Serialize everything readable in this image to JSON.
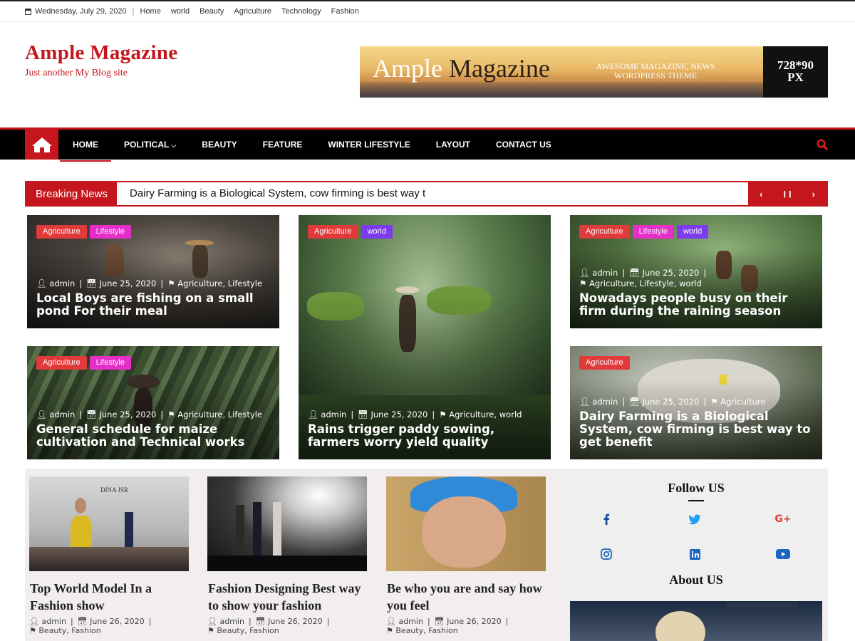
{
  "topbar": {
    "date": "Wednesday, July 29, 2020",
    "links": [
      "Home",
      "world",
      "Beauty",
      "Agriculture",
      "Technology",
      "Fashion"
    ]
  },
  "site": {
    "title": "Ample Magazine",
    "tagline": "Just another My Blog site"
  },
  "ad": {
    "name_dark": "Ample",
    "name_light": " Magazine",
    "desc": "AWESOME MAGAZINE, NEWS WORDPRESS THEME",
    "size_line1": "728*90",
    "size_line2": "PX"
  },
  "nav": {
    "items": [
      "HOME",
      "POLITICAL",
      "BEAUTY",
      "FEATURE",
      "WINTER LIFESTYLE",
      "LAYOUT",
      "CONTACT US"
    ],
    "active": "HOME"
  },
  "breaking": {
    "label": "Breaking News",
    "text": "Dairy Farming is a Biological System, cow firming is best way t",
    "prev": "‹",
    "pause": "❙❙",
    "next": "›"
  },
  "featured": [
    {
      "tags": [
        "Agriculture",
        "Lifestyle"
      ],
      "author": "admin",
      "date": "June 25, 2020",
      "cats": "Agriculture, Lifestyle",
      "title": "Local Boys are fishing on a small pond For their meal"
    },
    {
      "tags": [
        "Agriculture",
        "world"
      ],
      "author": "admin",
      "date": "June 25, 2020",
      "cats": "Agriculture, world",
      "title": "Rains trigger paddy sowing, farmers worry yield quality"
    },
    {
      "tags": [
        "Agriculture",
        "Lifestyle",
        "world"
      ],
      "author": "admin",
      "date": "June 25, 2020",
      "cats": "Agriculture, Lifestyle, world",
      "title": "Nowadays people busy on their firm during the raining season"
    },
    {
      "tags": [
        "Agriculture",
        "Lifestyle"
      ],
      "author": "admin",
      "date": "June 25, 2020",
      "cats": "Agriculture, Lifestyle",
      "title": "General schedule for maize cultivation and Technical works"
    },
    {
      "tags": [
        "Agriculture"
      ],
      "author": "admin",
      "date": "June 25, 2020",
      "cats": "Agriculture",
      "title": "Dairy Farming is a Biological System, cow firming is best way to get benefit"
    }
  ],
  "posts": [
    {
      "title": "Top World Model In a Fashion show",
      "author": "admin",
      "date": "June 26, 2020",
      "cats": "Beauty, Fashion",
      "image_text": "DINA JSR"
    },
    {
      "title": "Fashion Designing Best way to show your fashion",
      "author": "admin",
      "date": "June 26, 2020",
      "cats": "Beauty, Fashion"
    },
    {
      "title": "Be who you are and say how you feel",
      "author": "admin",
      "date": "June 26, 2020",
      "cats": "Beauty, Fashion"
    }
  ],
  "sidebar": {
    "follow_title": "Follow US",
    "about_title": "About US",
    "social_icons": [
      "facebook-icon",
      "twitter-icon",
      "google-plus-icon",
      "instagram-icon",
      "linkedin-icon",
      "youtube-icon"
    ]
  },
  "colors": {
    "brand": "#c4161c",
    "tag_red": "#e03a3a",
    "tag_pink": "#e62ec9",
    "tag_purple": "#7b3bf0"
  }
}
